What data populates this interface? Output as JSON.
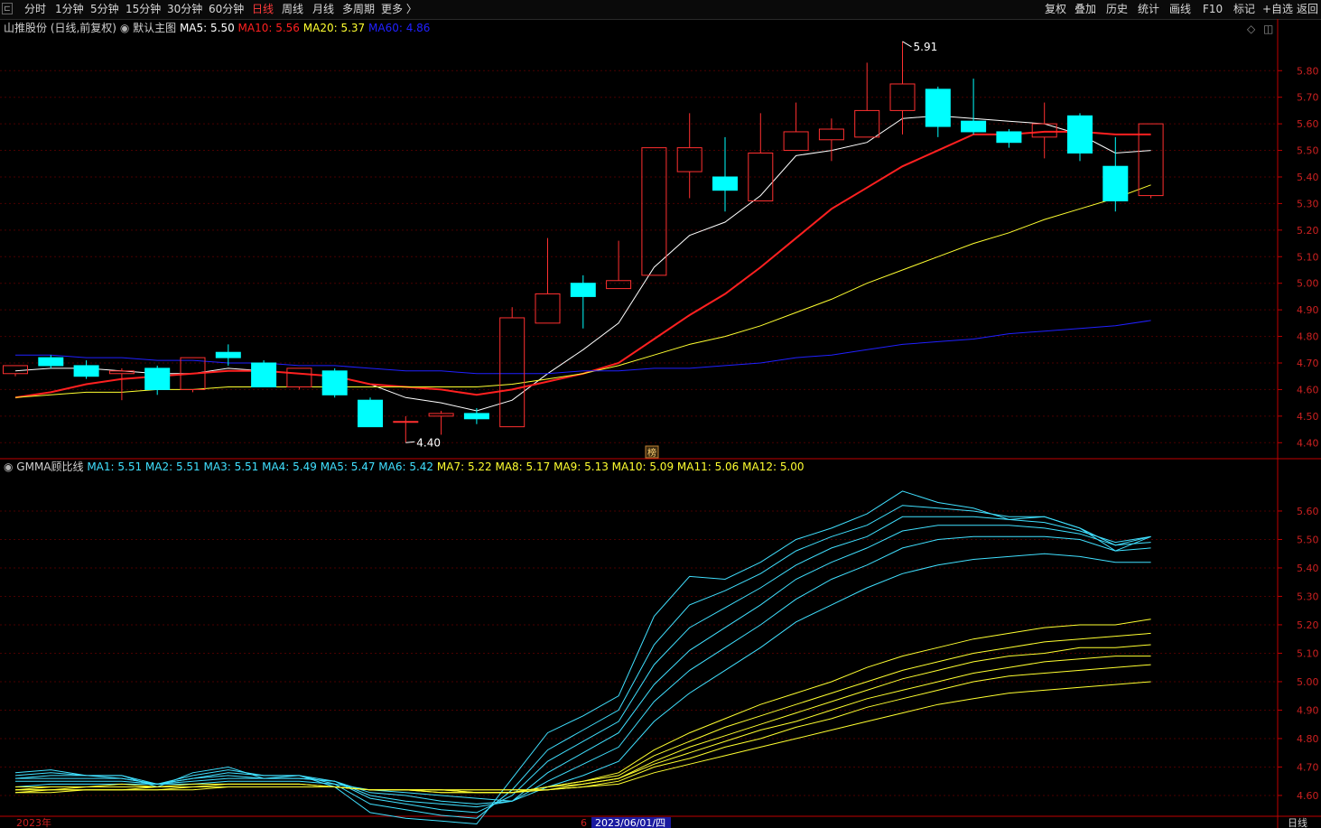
{
  "toolbar": {
    "periods": [
      "分时",
      "1分钟",
      "5分钟",
      "15分钟",
      "30分钟",
      "60分钟",
      "日线",
      "周线",
      "月线",
      "多周期",
      "更多 〉"
    ],
    "active_period": "日线",
    "right_buttons": [
      "复权",
      "叠加",
      "历史",
      "统计",
      "画线",
      "F10",
      "标记",
      "+自选",
      "返回"
    ]
  },
  "main_header": {
    "stock": "山推股份 (日线,前复权)",
    "circle": "◉",
    "indicator": "默认主图",
    "ma": [
      {
        "label": "MA5: 5.50",
        "color": "#ffffff"
      },
      {
        "label": "MA10: 5.56",
        "color": "#ff2020"
      },
      {
        "label": "MA20: 5.37",
        "color": "#ffff30"
      },
      {
        "label": "MA60: 4.86",
        "color": "#2020ff"
      }
    ],
    "corner_icons": [
      "◇",
      "◫"
    ]
  },
  "sub_header": {
    "name": "GMMA顾比线",
    "circle": "◉",
    "values": [
      {
        "label": "MA1: 5.51",
        "color": "#40e0ff"
      },
      {
        "label": "MA2: 5.51",
        "color": "#40e0ff"
      },
      {
        "label": "MA3: 5.51",
        "color": "#40e0ff"
      },
      {
        "label": "MA4: 5.49",
        "color": "#40e0ff"
      },
      {
        "label": "MA5: 5.47",
        "color": "#40e0ff"
      },
      {
        "label": "MA6: 5.42",
        "color": "#40e0ff"
      },
      {
        "label": "MA7: 5.22",
        "color": "#ffff30"
      },
      {
        "label": "MA8: 5.17",
        "color": "#ffff30"
      },
      {
        "label": "MA9: 5.13",
        "color": "#ffff30"
      },
      {
        "label": "MA10: 5.09",
        "color": "#ffff30"
      },
      {
        "label": "MA11: 5.06",
        "color": "#ffff30"
      },
      {
        "label": "MA12: 5.00",
        "color": "#ffff30"
      }
    ]
  },
  "bottom_axis": {
    "year_label": "2023年",
    "marker": "6",
    "cursor_date": "2023/06/01/四",
    "period_label": "日线"
  },
  "annotations": {
    "high": "5.91",
    "low": "4.40",
    "marker_icon": "榜"
  },
  "colors": {
    "up": "#ff3030",
    "down": "#00ffff",
    "grid": "#4a0000",
    "axis": "#c00000",
    "tick": "#cc2020"
  },
  "chart_data": [
    {
      "type": "candlestick",
      "title": "山推股份 (日线,前复权)",
      "ylim": [
        4.35,
        5.93
      ],
      "y_ticks": [
        4.4,
        4.5,
        4.6,
        4.7,
        4.8,
        4.9,
        5.0,
        5.1,
        5.2,
        5.3,
        5.4,
        5.5,
        5.6,
        5.7,
        5.8
      ],
      "candles": [
        {
          "o": 4.66,
          "h": 4.69,
          "l": 4.65,
          "c": 4.69
        },
        {
          "o": 4.72,
          "h": 4.73,
          "l": 4.68,
          "c": 4.69
        },
        {
          "o": 4.69,
          "h": 4.71,
          "l": 4.64,
          "c": 4.65
        },
        {
          "o": 4.66,
          "h": 4.68,
          "l": 4.56,
          "c": 4.67
        },
        {
          "o": 4.68,
          "h": 4.69,
          "l": 4.58,
          "c": 4.6
        },
        {
          "o": 4.6,
          "h": 4.72,
          "l": 4.59,
          "c": 4.72
        },
        {
          "o": 4.74,
          "h": 4.77,
          "l": 4.69,
          "c": 4.72
        },
        {
          "o": 4.7,
          "h": 4.71,
          "l": 4.61,
          "c": 4.61
        },
        {
          "o": 4.61,
          "h": 4.68,
          "l": 4.6,
          "c": 4.68
        },
        {
          "o": 4.67,
          "h": 4.68,
          "l": 4.57,
          "c": 4.58
        },
        {
          "o": 4.56,
          "h": 4.57,
          "l": 4.46,
          "c": 4.46
        },
        {
          "o": 4.48,
          "h": 4.5,
          "l": 4.4,
          "c": 4.48
        },
        {
          "o": 4.5,
          "h": 4.52,
          "l": 4.43,
          "c": 4.51
        },
        {
          "o": 4.51,
          "h": 4.53,
          "l": 4.47,
          "c": 4.49
        },
        {
          "o": 4.46,
          "h": 4.91,
          "l": 4.46,
          "c": 4.87
        },
        {
          "o": 4.85,
          "h": 5.17,
          "l": 4.85,
          "c": 4.96
        },
        {
          "o": 5.0,
          "h": 5.03,
          "l": 4.83,
          "c": 4.95
        },
        {
          "o": 4.98,
          "h": 5.16,
          "l": 4.98,
          "c": 5.01
        },
        {
          "o": 5.03,
          "h": 5.51,
          "l": 5.03,
          "c": 5.51
        },
        {
          "o": 5.42,
          "h": 5.64,
          "l": 5.32,
          "c": 5.51
        },
        {
          "o": 5.4,
          "h": 5.55,
          "l": 5.27,
          "c": 5.35
        },
        {
          "o": 5.31,
          "h": 5.64,
          "l": 5.31,
          "c": 5.49
        },
        {
          "o": 5.5,
          "h": 5.68,
          "l": 5.5,
          "c": 5.57
        },
        {
          "o": 5.54,
          "h": 5.62,
          "l": 5.46,
          "c": 5.58
        },
        {
          "o": 5.55,
          "h": 5.83,
          "l": 5.55,
          "c": 5.65
        },
        {
          "o": 5.65,
          "h": 5.91,
          "l": 5.56,
          "c": 5.75
        },
        {
          "o": 5.73,
          "h": 5.74,
          "l": 5.55,
          "c": 5.59
        },
        {
          "o": 5.61,
          "h": 5.77,
          "l": 5.56,
          "c": 5.57
        },
        {
          "o": 5.57,
          "h": 5.58,
          "l": 5.51,
          "c": 5.53
        },
        {
          "o": 5.55,
          "h": 5.68,
          "l": 5.47,
          "c": 5.6
        },
        {
          "o": 5.63,
          "h": 5.64,
          "l": 5.46,
          "c": 5.49
        },
        {
          "o": 5.44,
          "h": 5.55,
          "l": 5.27,
          "c": 5.31
        },
        {
          "o": 5.33,
          "h": 5.6,
          "l": 5.32,
          "c": 5.6
        }
      ],
      "ma_lines": [
        {
          "name": "MA5",
          "color": "#ffffff",
          "values": [
            4.67,
            4.68,
            4.68,
            4.67,
            4.66,
            4.66,
            4.68,
            4.67,
            4.66,
            4.65,
            4.62,
            4.57,
            4.55,
            4.52,
            4.56,
            4.66,
            4.75,
            4.85,
            5.06,
            5.18,
            5.23,
            5.33,
            5.48,
            5.5,
            5.53,
            5.62,
            5.63,
            5.62,
            5.61,
            5.6,
            5.56,
            5.49,
            5.5
          ]
        },
        {
          "name": "MA10",
          "color": "#ff2020",
          "values": [
            4.57,
            4.59,
            4.62,
            4.64,
            4.65,
            4.66,
            4.67,
            4.67,
            4.66,
            4.65,
            4.62,
            4.61,
            4.6,
            4.58,
            4.6,
            4.63,
            4.66,
            4.7,
            4.79,
            4.88,
            4.96,
            5.06,
            5.17,
            5.28,
            5.36,
            5.44,
            5.5,
            5.56,
            5.56,
            5.57,
            5.57,
            5.56,
            5.56
          ]
        },
        {
          "name": "MA20",
          "color": "#ffff30",
          "values": [
            4.57,
            4.58,
            4.59,
            4.59,
            4.6,
            4.6,
            4.61,
            4.61,
            4.61,
            4.61,
            4.61,
            4.61,
            4.61,
            4.61,
            4.62,
            4.64,
            4.66,
            4.69,
            4.73,
            4.77,
            4.8,
            4.84,
            4.89,
            4.94,
            5.0,
            5.05,
            5.1,
            5.15,
            5.19,
            5.24,
            5.28,
            5.32,
            5.37
          ]
        },
        {
          "name": "MA60",
          "color": "#2020ff",
          "values": [
            4.73,
            4.73,
            4.72,
            4.72,
            4.71,
            4.71,
            4.7,
            4.7,
            4.69,
            4.69,
            4.68,
            4.67,
            4.67,
            4.66,
            4.66,
            4.66,
            4.67,
            4.67,
            4.68,
            4.68,
            4.69,
            4.7,
            4.72,
            4.73,
            4.75,
            4.77,
            4.78,
            4.79,
            4.81,
            4.82,
            4.83,
            4.84,
            4.86
          ]
        }
      ]
    },
    {
      "type": "line",
      "title": "GMMA顾比线",
      "ylim": [
        4.53,
        5.73
      ],
      "y_ticks": [
        4.6,
        4.7,
        4.8,
        4.9,
        5.0,
        5.1,
        5.2,
        5.3,
        5.4,
        5.5,
        5.6
      ],
      "series": [
        {
          "name": "MA1",
          "color": "#40e0ff",
          "values": [
            4.68,
            4.69,
            4.67,
            4.67,
            4.63,
            4.68,
            4.7,
            4.66,
            4.67,
            4.63,
            4.54,
            4.52,
            4.51,
            4.5,
            4.66,
            4.82,
            4.88,
            4.95,
            5.23,
            5.37,
            5.36,
            5.42,
            5.5,
            5.54,
            5.59,
            5.67,
            5.63,
            5.61,
            5.57,
            5.58,
            5.54,
            5.46,
            5.51
          ]
        },
        {
          "name": "MA2",
          "color": "#40e0ff",
          "values": [
            4.67,
            4.68,
            4.67,
            4.67,
            4.64,
            4.67,
            4.69,
            4.67,
            4.67,
            4.64,
            4.57,
            4.55,
            4.53,
            4.52,
            4.62,
            4.76,
            4.83,
            4.9,
            5.13,
            5.27,
            5.32,
            5.38,
            5.46,
            5.51,
            5.55,
            5.62,
            5.61,
            5.6,
            5.58,
            5.58,
            5.54,
            5.48,
            5.51
          ]
        },
        {
          "name": "MA3",
          "color": "#40e0ff",
          "values": [
            4.66,
            4.67,
            4.67,
            4.66,
            4.64,
            4.66,
            4.68,
            4.67,
            4.67,
            4.65,
            4.59,
            4.57,
            4.55,
            4.54,
            4.6,
            4.72,
            4.79,
            4.86,
            5.06,
            5.19,
            5.26,
            5.33,
            5.41,
            5.47,
            5.51,
            5.58,
            5.58,
            5.58,
            5.57,
            5.56,
            5.53,
            5.49,
            5.51
          ]
        },
        {
          "name": "MA4",
          "color": "#40e0ff",
          "values": [
            4.66,
            4.66,
            4.66,
            4.66,
            4.64,
            4.66,
            4.67,
            4.66,
            4.66,
            4.65,
            4.6,
            4.58,
            4.57,
            4.56,
            4.58,
            4.68,
            4.75,
            4.82,
            4.99,
            5.11,
            5.19,
            5.27,
            5.36,
            5.42,
            5.47,
            5.53,
            5.55,
            5.55,
            5.55,
            5.54,
            5.52,
            5.48,
            5.49
          ]
        },
        {
          "name": "MA5",
          "color": "#40e0ff",
          "values": [
            4.65,
            4.65,
            4.65,
            4.65,
            4.64,
            4.65,
            4.66,
            4.66,
            4.66,
            4.65,
            4.61,
            4.6,
            4.58,
            4.57,
            4.58,
            4.65,
            4.71,
            4.77,
            4.93,
            5.04,
            5.12,
            5.2,
            5.29,
            5.36,
            5.41,
            5.47,
            5.5,
            5.51,
            5.51,
            5.51,
            5.5,
            5.46,
            5.47
          ]
        },
        {
          "name": "MA6",
          "color": "#40e0ff",
          "values": [
            4.63,
            4.64,
            4.64,
            4.64,
            4.64,
            4.64,
            4.65,
            4.65,
            4.65,
            4.64,
            4.62,
            4.61,
            4.6,
            4.59,
            4.58,
            4.63,
            4.67,
            4.72,
            4.86,
            4.96,
            5.04,
            5.12,
            5.21,
            5.27,
            5.33,
            5.38,
            5.41,
            5.43,
            5.44,
            5.45,
            5.44,
            5.42,
            5.42
          ]
        },
        {
          "name": "MA7",
          "color": "#ffff30",
          "values": [
            4.63,
            4.63,
            4.63,
            4.64,
            4.63,
            4.64,
            4.64,
            4.64,
            4.64,
            4.63,
            4.62,
            4.62,
            4.61,
            4.61,
            4.61,
            4.63,
            4.65,
            4.68,
            4.76,
            4.82,
            4.87,
            4.92,
            4.96,
            5.0,
            5.05,
            5.09,
            5.12,
            5.15,
            5.17,
            5.19,
            5.2,
            5.2,
            5.22
          ]
        },
        {
          "name": "MA8",
          "color": "#ffff30",
          "values": [
            4.62,
            4.63,
            4.63,
            4.63,
            4.63,
            4.63,
            4.64,
            4.64,
            4.64,
            4.63,
            4.62,
            4.62,
            4.61,
            4.61,
            4.61,
            4.63,
            4.65,
            4.67,
            4.74,
            4.79,
            4.84,
            4.88,
            4.92,
            4.96,
            5.0,
            5.04,
            5.07,
            5.1,
            5.12,
            5.14,
            5.15,
            5.16,
            5.17
          ]
        },
        {
          "name": "MA9",
          "color": "#ffff30",
          "values": [
            4.62,
            4.62,
            4.63,
            4.63,
            4.63,
            4.63,
            4.63,
            4.63,
            4.63,
            4.63,
            4.62,
            4.62,
            4.62,
            4.61,
            4.61,
            4.63,
            4.64,
            4.66,
            4.72,
            4.77,
            4.81,
            4.85,
            4.89,
            4.93,
            4.97,
            5.01,
            5.04,
            5.07,
            5.09,
            5.1,
            5.12,
            5.12,
            5.13
          ]
        },
        {
          "name": "MA10",
          "color": "#ffff30",
          "values": [
            4.62,
            4.62,
            4.62,
            4.62,
            4.63,
            4.63,
            4.63,
            4.63,
            4.63,
            4.63,
            4.62,
            4.62,
            4.62,
            4.61,
            4.61,
            4.62,
            4.64,
            4.66,
            4.71,
            4.75,
            4.79,
            4.83,
            4.86,
            4.9,
            4.94,
            4.97,
            5.0,
            5.03,
            5.05,
            5.07,
            5.08,
            5.09,
            5.09
          ]
        },
        {
          "name": "MA11",
          "color": "#ffff30",
          "values": [
            4.61,
            4.62,
            4.62,
            4.62,
            4.62,
            4.63,
            4.63,
            4.63,
            4.63,
            4.63,
            4.62,
            4.62,
            4.62,
            4.62,
            4.62,
            4.62,
            4.63,
            4.65,
            4.7,
            4.73,
            4.77,
            4.8,
            4.84,
            4.87,
            4.91,
            4.94,
            4.97,
            5.0,
            5.02,
            5.03,
            5.04,
            5.05,
            5.06
          ]
        },
        {
          "name": "MA12",
          "color": "#ffff30",
          "values": [
            4.61,
            4.61,
            4.62,
            4.62,
            4.62,
            4.62,
            4.63,
            4.63,
            4.63,
            4.63,
            4.62,
            4.62,
            4.62,
            4.62,
            4.62,
            4.62,
            4.63,
            4.64,
            4.68,
            4.71,
            4.74,
            4.77,
            4.8,
            4.83,
            4.86,
            4.89,
            4.92,
            4.94,
            4.96,
            4.97,
            4.98,
            4.99,
            5.0
          ]
        }
      ]
    }
  ]
}
